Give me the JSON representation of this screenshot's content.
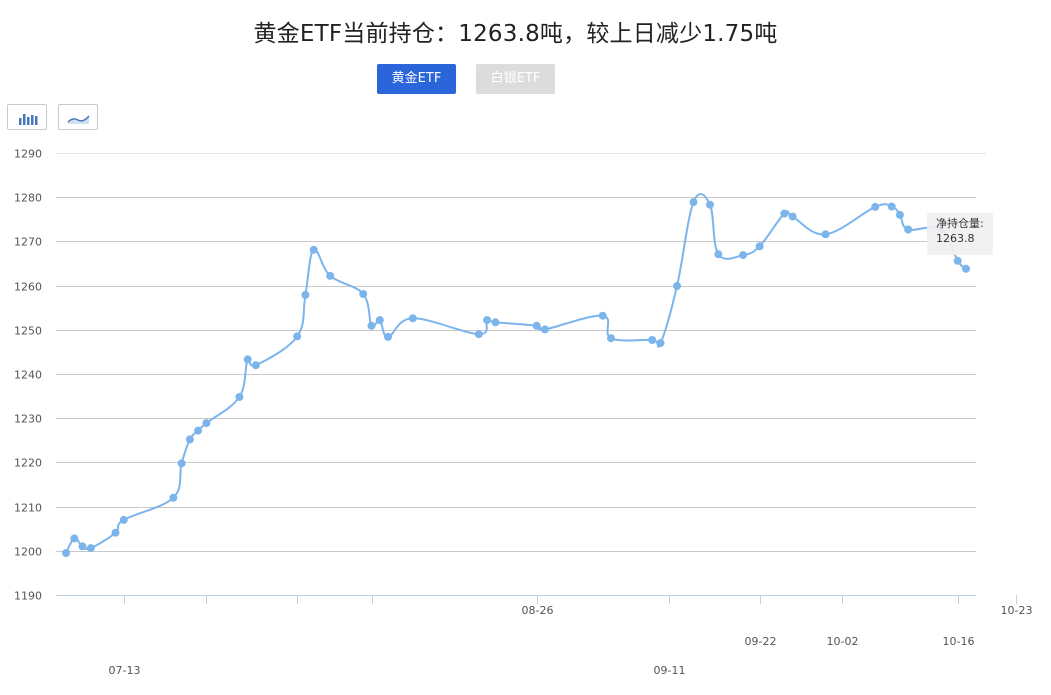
{
  "title": "黄金ETF当前持仓：1263.8吨，较上日减少1.75吨",
  "tabs": {
    "gold": "黄金ETF",
    "silver": "白银ETF"
  },
  "toolbar": {
    "bar_icon": "bar-chart-icon",
    "line_icon": "line-chart-icon"
  },
  "tooltip": {
    "label": "净持仓量:",
    "value": "1263.8"
  },
  "colors": {
    "line": "#7cb5ec",
    "active_tab": "#2a66d9",
    "inactive_tab": "#dcdcdc"
  },
  "chart_data": {
    "type": "line",
    "title": "",
    "xlabel": "",
    "ylabel": "",
    "ylim": [
      1190,
      1290
    ],
    "yticks": [
      1190,
      1200,
      1210,
      1220,
      1230,
      1240,
      1250,
      1260,
      1270,
      1280,
      1290
    ],
    "grid": true,
    "xtick_labels": [
      {
        "label": "07-13",
        "x": 7.0,
        "row": 2
      },
      {
        "label": "08-26",
        "x": 57.0,
        "row": 0
      },
      {
        "label": "09-11",
        "x": 73.0,
        "row": 2
      },
      {
        "label": "09-22",
        "x": 84.0,
        "row": 1
      },
      {
        "label": "10-02",
        "x": 94.0,
        "row": 1
      },
      {
        "label": "10-16",
        "x": 108.0,
        "row": 1
      },
      {
        "label": "10-23",
        "x": 115.0,
        "row": 0
      }
    ],
    "minor_ticks_x": [
      17.0,
      28.0,
      37.0,
      73.0
    ],
    "series": [
      {
        "x": [
          0.0,
          1.0,
          2.0,
          3.0,
          6.0,
          7.0,
          13.0,
          14.0,
          15.0,
          16.0,
          17.0,
          21.0,
          22.0,
          23.0,
          28.0,
          29.0,
          30.0,
          32.0,
          36.0,
          37.0,
          38.0,
          39.0,
          42.0,
          50.0,
          51.0,
          52.0,
          57.0,
          58.0,
          65.0,
          66.0,
          71.0,
          72.0,
          74.0,
          76.0,
          78.0,
          79.0,
          82.0,
          84.0,
          87.0,
          88.0,
          92.0,
          98.0,
          100.0,
          101.0,
          102.0,
          106.0,
          108.0,
          109.0
        ],
        "values": [
          1199.5,
          1202.8,
          1201.0,
          1200.6,
          1204.1,
          1207.0,
          1212.0,
          1219.8,
          1225.2,
          1227.2,
          1228.9,
          1234.8,
          1243.3,
          1242.0,
          1248.5,
          1257.9,
          1268.1,
          1262.2,
          1258.1,
          1250.9,
          1252.2,
          1248.4,
          1252.6,
          1249.0,
          1252.2,
          1251.7,
          1250.9,
          1250.1,
          1253.2,
          1248.1,
          1247.7,
          1247.0,
          1259.9,
          1278.9,
          1278.3,
          1267.1,
          1266.9,
          1268.9,
          1276.3,
          1275.6,
          1271.6,
          1277.8,
          1277.9,
          1276.0,
          1272.7,
          1272.8,
          1265.6,
          1263.8
        ]
      }
    ]
  }
}
